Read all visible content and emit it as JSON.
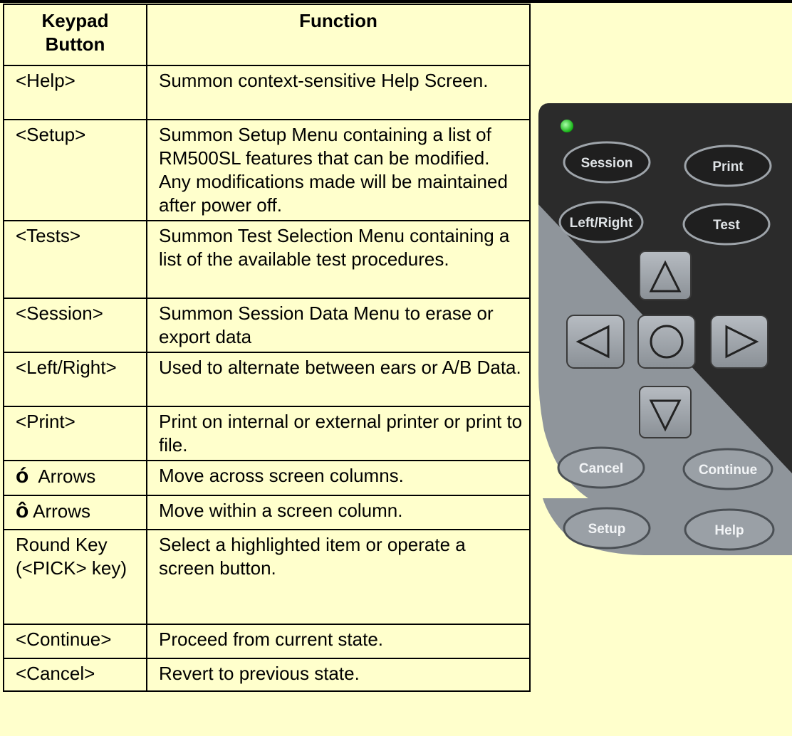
{
  "table": {
    "header": {
      "key": "Keypad Button",
      "function": "Function"
    },
    "rows": [
      {
        "key": "<Help>",
        "function": "Summon context-sensitive Help Screen."
      },
      {
        "key": "<Setup>",
        "function": "Summon Setup Menu containing a list of RM500SL features that can be modified. Any modifications made will be maintained after power off."
      },
      {
        "key": "<Tests>",
        "function": "Summon Test Selection Menu containing a list of the available test procedures."
      },
      {
        "key": "<Session>",
        "function": "Summon Session Data Menu to erase or export data"
      },
      {
        "key": "<Left/Right>",
        "function": "Used to alternate between ears or A/B Data."
      },
      {
        "key": "<Print>",
        "function": "Print on internal or external printer or print to file."
      },
      {
        "key_glyph": "ó",
        "key": "Arrows",
        "function": "Move across screen columns."
      },
      {
        "key_glyph": "ô",
        "key": "Arrows",
        "function": "Move within a screen column."
      },
      {
        "key": "Round Key (<PICK> key)",
        "function": "Select a highlighted item or operate a screen button."
      },
      {
        "key": "<Continue>",
        "function": "Proceed from current state."
      },
      {
        "key": "<Cancel>",
        "function": "Revert to previous state."
      }
    ]
  },
  "remote": {
    "buttons": {
      "session": "Session",
      "print": "Print",
      "left_right": "Left/Right",
      "test": "Test",
      "cancel": "Cancel",
      "continue": "Continue",
      "setup": "Setup",
      "help": "Help"
    },
    "icons": [
      "up-arrow-icon",
      "left-arrow-icon",
      "round-pick-icon",
      "right-arrow-icon",
      "down-arrow-icon"
    ],
    "colors": {
      "dark": "#2b2b2b",
      "grey": "#8a9096",
      "led": "#22dd22"
    }
  }
}
